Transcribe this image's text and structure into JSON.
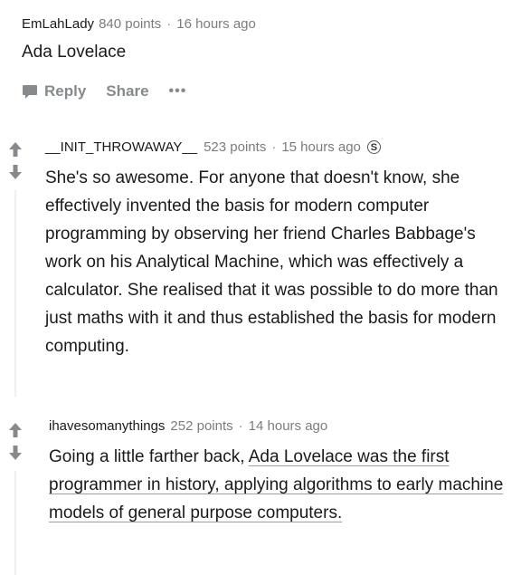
{
  "comment1": {
    "username": "EmLahLady",
    "points": "840 points",
    "separator": "·",
    "time": "16 hours ago",
    "body": "Ada Lovelace",
    "actions": {
      "reply_label": "Reply",
      "share_label": "Share",
      "more_label": "•••"
    }
  },
  "comment2": {
    "username": "__INIT_THROWAWAY__",
    "points": "523 points",
    "separator": "·",
    "time": "15 hours ago",
    "badge": "S",
    "body": "She's so awesome. For anyone that doesn't know, she effectively invented the basis for modern computer programming by observing her friend Charles Babbage's work on his Analytical Machine, which was effectively a calculator. She realised that it was possible to do more than just maths with it and thus established the basis for modern computing."
  },
  "comment3": {
    "username": "ihavesomanythings",
    "points": "252 points",
    "separator": "·",
    "time": "14 hours ago",
    "body_prefix": "Going a little farther back, ",
    "body_link": "Ada Lovelace was the first programmer in history, applying algorithms to early machine models of general purpose computers."
  },
  "colors": {
    "meta_text": "#7c7c7c",
    "action_text": "#878a8c",
    "body_text": "#1a1a1b",
    "thread_line": "#edeff1",
    "vote_arrow": "#878a8c"
  },
  "icons": {
    "upvote": "upvote-arrow-icon",
    "downvote": "downvote-arrow-icon",
    "reply": "comment-bubble-icon",
    "badge": "s-circle-badge-icon"
  }
}
